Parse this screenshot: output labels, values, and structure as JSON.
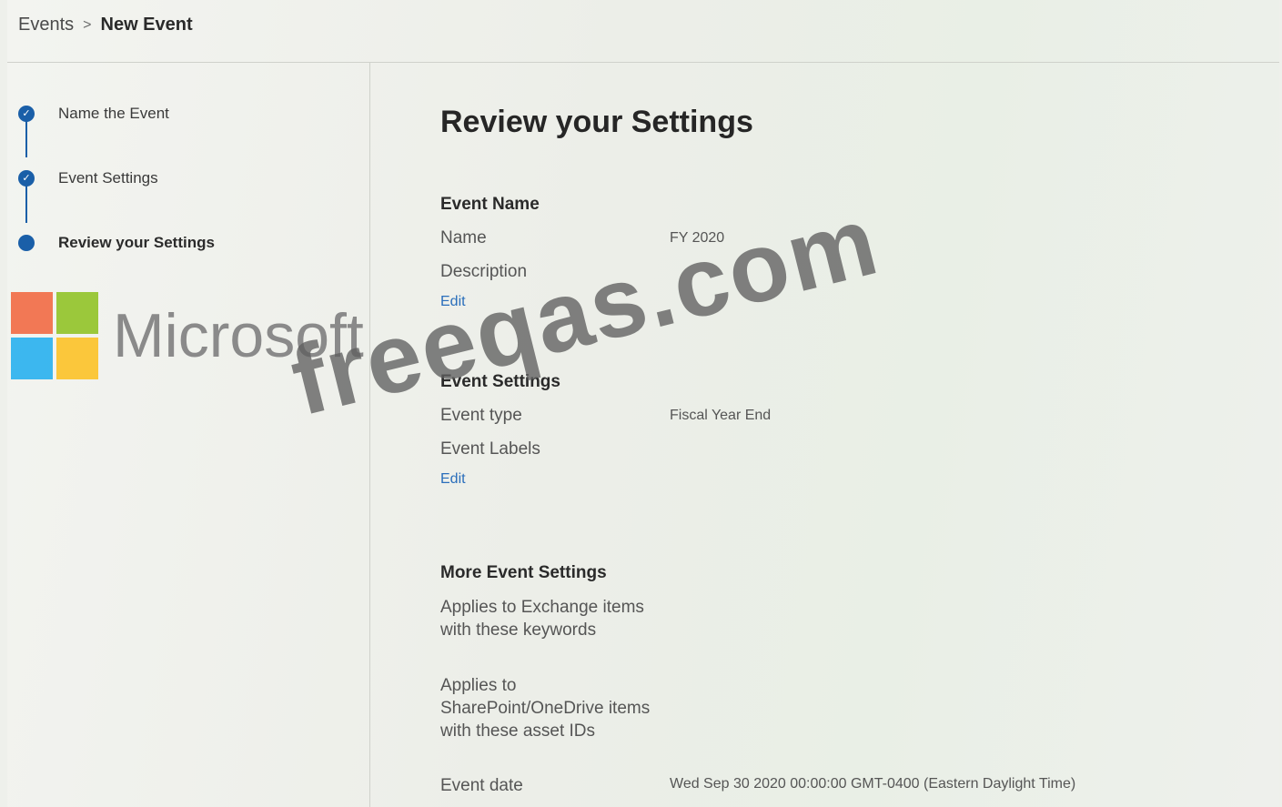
{
  "breadcrumb": {
    "root": "Events",
    "separator": ">",
    "current": "New Event"
  },
  "stepper": {
    "steps": [
      {
        "label": "Name the Event",
        "state": "completed"
      },
      {
        "label": "Event Settings",
        "state": "completed"
      },
      {
        "label": "Review your Settings",
        "state": "current"
      }
    ],
    "check_glyph": "✓"
  },
  "logo": {
    "wordmark": "Microsoft",
    "colors": [
      "#f25022",
      "#7fba00",
      "#00a4ef",
      "#ffb900"
    ]
  },
  "main": {
    "title": "Review your Settings",
    "event_name_section": {
      "heading": "Event Name",
      "name_label": "Name",
      "name_value": "FY 2020",
      "description_label": "Description",
      "edit_label": "Edit"
    },
    "event_settings_section": {
      "heading": "Event Settings",
      "type_label": "Event type",
      "type_value": "Fiscal Year End",
      "labels_label": "Event Labels",
      "edit_label": "Edit"
    },
    "more_settings_section": {
      "heading": "More Event Settings",
      "exchange_label": "Applies to Exchange items with these keywords",
      "sharepoint_label": "Applies to SharePoint/OneDrive items with these asset IDs",
      "date_label": "Event date",
      "date_value": "Wed Sep 30 2020 00:00:00 GMT-0400 (Eastern Daylight Time)"
    }
  },
  "watermark": "freeqas.com",
  "colors": {
    "accent": "#1a5fa8",
    "link": "#2a6ebb"
  }
}
